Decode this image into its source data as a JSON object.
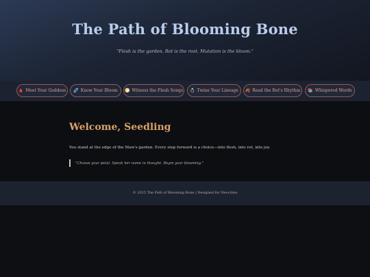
{
  "header": {
    "title": "The Path of Blooming Bone",
    "tagline": "\"Flesh is the garden. Rot is the root. Mutation is the bloom.\""
  },
  "nav": {
    "items": [
      {
        "icon": "🩸",
        "icon_name": "blood-drop-icon",
        "label": "Meet Your Goddess"
      },
      {
        "icon": "🧬",
        "icon_name": "dna-icon",
        "label": "Know Your Bloom"
      },
      {
        "icon": "🌕",
        "icon_name": "full-moon-icon",
        "label": "Witness the Flesh Songs"
      },
      {
        "icon": "💍",
        "icon_name": "ring-icon",
        "label": "Twine Your Lineage"
      },
      {
        "icon": "🍂",
        "icon_name": "fallen-leaf-icon",
        "label": "Read the Rot's Rhythm"
      },
      {
        "icon": "📚",
        "icon_name": "books-icon",
        "label": "Whispered Words"
      }
    ]
  },
  "main": {
    "heading": "Welcome, Seedling",
    "intro": "You stand at the edge of the Maw's garden. Every step forward is a choice—into flesh, into rot, into joy.",
    "quote": "\"Choose your petal. Speak her name in thought. Begin your blooming.\""
  },
  "footer": {
    "text": "© 2025 The Path of Blooming Bone | Designed for Neocities"
  },
  "colors": {
    "accent_title": "#b9cdea",
    "accent_heading": "#d9a06a",
    "nav_text": "#e2a290",
    "nav_border": "#8a5d5a"
  }
}
